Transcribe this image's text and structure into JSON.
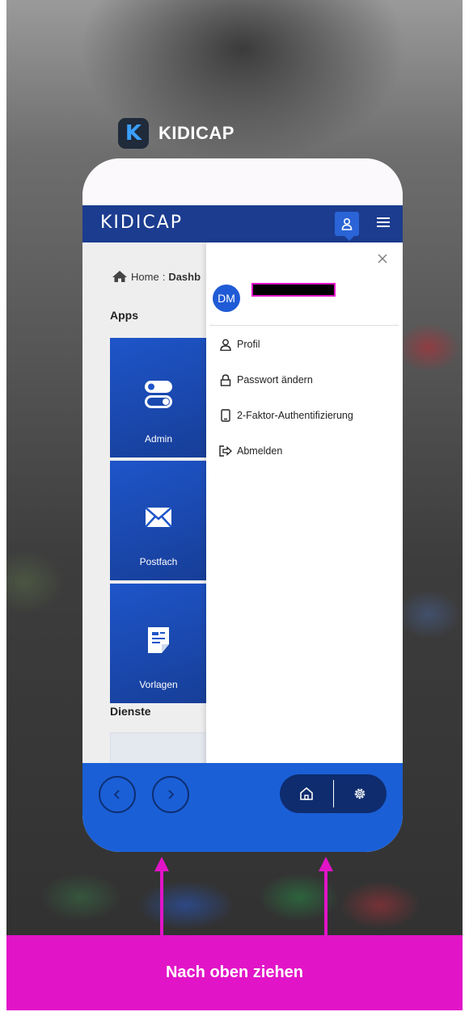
{
  "app_switcher": {
    "app_name": "KIDICAP",
    "app_icon_letter": "K"
  },
  "app": {
    "brand": "KIDICAP",
    "breadcrumb": {
      "home": "Home",
      "separator": ":",
      "current": "Dashb"
    },
    "sections": {
      "apps": "Apps",
      "services": "Dienste"
    },
    "tiles": [
      {
        "label": "Admin",
        "icon": "toggle-icon"
      },
      {
        "label": "Postfach",
        "icon": "mail-icon"
      },
      {
        "label": "Vorlagen",
        "icon": "document-icon"
      }
    ]
  },
  "drawer": {
    "avatar_initials": "DM",
    "menu": [
      {
        "label": "Profil",
        "icon": "user-icon"
      },
      {
        "label": "Passwort ändern",
        "icon": "lock-icon"
      },
      {
        "label": "2-Faktor-Authentifizierung",
        "icon": "phone-icon"
      },
      {
        "label": "Abmelden",
        "icon": "logout-icon"
      }
    ]
  },
  "instruction": {
    "text": "Nach oben ziehen"
  },
  "colors": {
    "accent": "#e214c8",
    "appbar": "#1b3c8f",
    "bottombar": "#1a5fd6",
    "tile": "#1e55c9"
  }
}
